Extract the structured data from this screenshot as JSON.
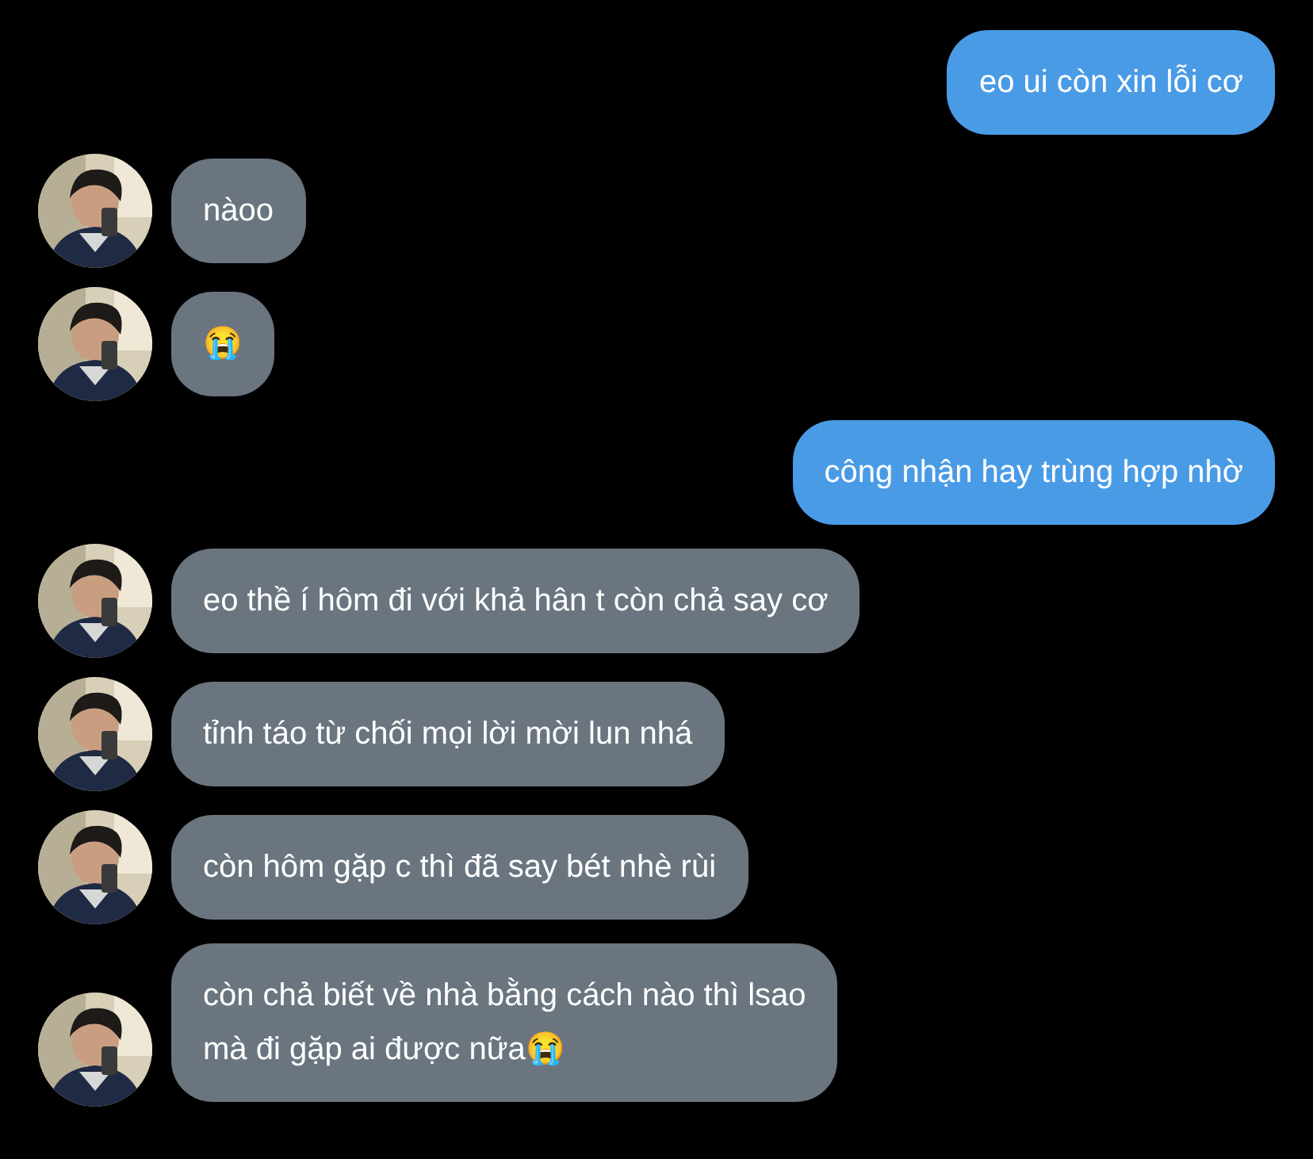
{
  "messages": [
    {
      "kind": "sent",
      "text": "eo ui còn xin lỗi cơ"
    },
    {
      "kind": "received",
      "text": "nàoo"
    },
    {
      "kind": "received",
      "text": "😭"
    },
    {
      "kind": "sent",
      "text": "công nhận hay trùng hợp nhờ"
    },
    {
      "kind": "received",
      "text": "eo thề í hôm đi với khả hân t còn chả say cơ"
    },
    {
      "kind": "received",
      "text": "tỉnh táo từ chối mọi lời mời lun nhá"
    },
    {
      "kind": "received",
      "text": "còn hôm gặp c thì đã say bét nhè rùi"
    },
    {
      "kind": "received",
      "text": "còn chả biết về nhà bằng cách nào thì lsao\nmà đi gặp ai được nữa😭"
    }
  ]
}
